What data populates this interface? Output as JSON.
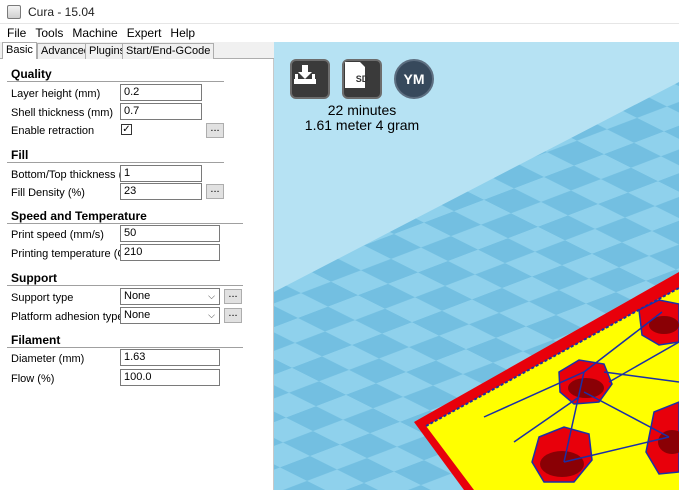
{
  "window": {
    "title": "Cura - 15.04"
  },
  "menu": [
    "File",
    "Tools",
    "Machine",
    "Expert",
    "Help"
  ],
  "tabs": [
    "Basic",
    "Advanced",
    "Plugins",
    "Start/End-GCode"
  ],
  "quality": {
    "header": "Quality",
    "layer_height": {
      "label": "Layer height (mm)",
      "value": "0.2"
    },
    "shell_thickness": {
      "label": "Shell thickness (mm)",
      "value": "0.7"
    },
    "enable_retraction": {
      "label": "Enable retraction",
      "checked": true
    }
  },
  "fill": {
    "header": "Fill",
    "bottom_top": {
      "label": "Bottom/Top thickness (mm)",
      "value": "1"
    },
    "density": {
      "label": "Fill Density (%)",
      "value": "23"
    }
  },
  "speed": {
    "header": "Speed and Temperature",
    "print_speed": {
      "label": "Print speed (mm/s)",
      "value": "50"
    },
    "print_temp": {
      "label": "Printing temperature (C)",
      "value": "210"
    }
  },
  "support": {
    "header": "Support",
    "type": {
      "label": "Support type",
      "value": "None"
    },
    "adhesion": {
      "label": "Platform adhesion type",
      "value": "None"
    }
  },
  "filament": {
    "header": "Filament",
    "diameter": {
      "label": "Diameter (mm)",
      "value": "1.63"
    },
    "flow": {
      "label": "Flow (%)",
      "value": "100.0"
    }
  },
  "dots_label": "...",
  "viewport": {
    "sd_label": "SD",
    "ym_label": "YM",
    "print_time": "22 minutes",
    "material": "1.61 meter 4 gram"
  },
  "icons": [
    "app-icon",
    "load-icon",
    "sd-card-icon",
    "ym-icon",
    "chevron-down-icon",
    "checkmark-icon"
  ],
  "colors": {
    "bed": "#92d3ee",
    "model_top": "#ffff00",
    "model_wall": "#e8000b",
    "infill_lines": "#1a2fa8",
    "panel_bg": "#ffffff"
  }
}
